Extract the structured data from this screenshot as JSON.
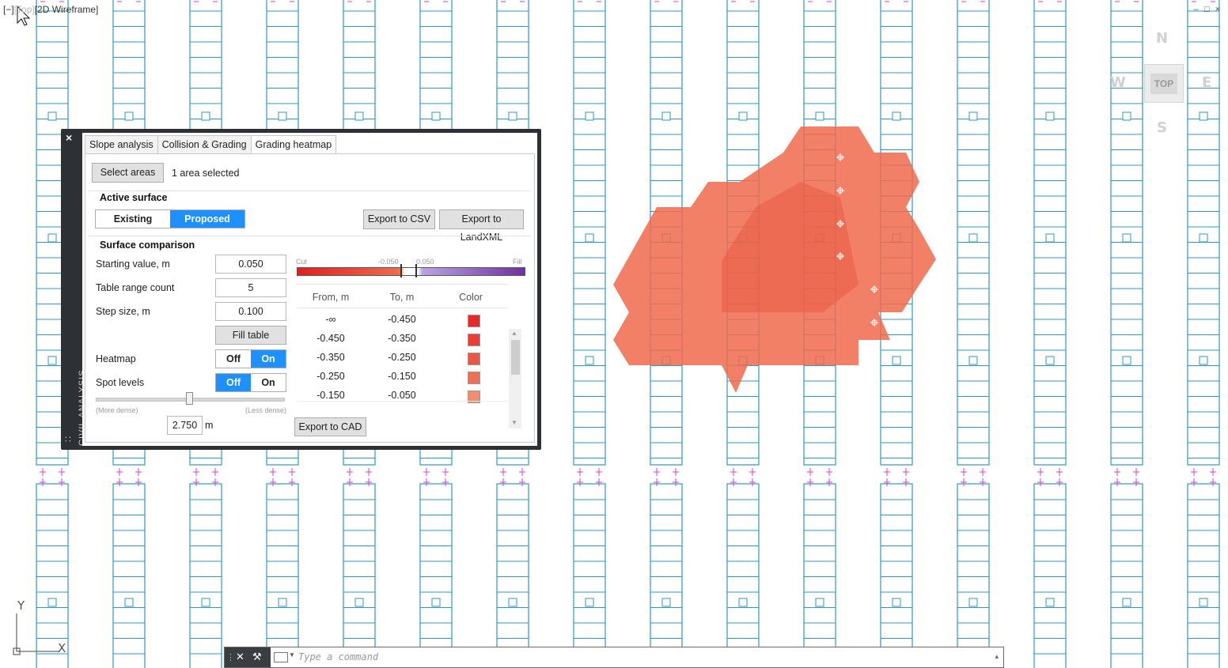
{
  "viewport": {
    "control_label": "[−]",
    "view_label": "[Top]",
    "style_label": "[2D Wireframe]",
    "window_controls": [
      "–",
      "□",
      "×"
    ]
  },
  "viewcube": {
    "n": "N",
    "s": "S",
    "e": "E",
    "w": "W",
    "face": "TOP"
  },
  "ucs": {
    "x": "X",
    "y": "Y"
  },
  "drawing_colors": {
    "rack": "#2b9ac4",
    "pile": "#d63fd6",
    "heatmap": "#ef6a4c"
  },
  "palette": {
    "title": "CIVIL ANALYSIS",
    "close": "×",
    "grip": "∷",
    "tabs": [
      "Slope analysis",
      "Collision & Grading",
      "Grading heatmap"
    ],
    "active_tab": 2,
    "select_areas": "Select areas",
    "selection_status": "1 area selected",
    "active_surface": {
      "header": "Active surface",
      "options": [
        "Existing",
        "Proposed"
      ],
      "selected": "Proposed"
    },
    "export_csv": "Export to CSV",
    "export_landxml": "Export to LandXML",
    "comparison": {
      "header": "Surface comparison",
      "starting_value_label": "Starting value, m",
      "starting_value": "0.050",
      "range_count_label": "Table range count",
      "range_count": "5",
      "step_size_label": "Step size, m",
      "step_size": "0.100",
      "fill_table": "Fill table",
      "heatmap_label": "Heatmap",
      "heatmap_options": [
        "Off",
        "On"
      ],
      "heatmap_selected": "On",
      "spot_levels_label": "Spot levels",
      "spot_levels_options": [
        "Off",
        "On"
      ],
      "spot_levels_selected": "Off",
      "density_more": "(More dense)",
      "density_less": "(Less dense)",
      "density_fraction": 0.5,
      "density_value": "2.750",
      "density_unit": "m"
    },
    "legend": {
      "cut": "Cut",
      "fill": "Fill",
      "low": "-0.050",
      "high": "0.050"
    },
    "table": {
      "headers": [
        "From, m",
        "To, m",
        "Color"
      ],
      "rows": [
        {
          "from": "-∞",
          "to": "-0.450",
          "color": "#e8282b"
        },
        {
          "from": "-0.450",
          "to": "-0.350",
          "color": "#ea3e37"
        },
        {
          "from": "-0.350",
          "to": "-0.250",
          "color": "#ec5645"
        },
        {
          "from": "-0.250",
          "to": "-0.150",
          "color": "#ef7056"
        },
        {
          "from": "-0.150",
          "to": "-0.050",
          "color": "#f28c6d"
        }
      ]
    },
    "export_cad": "Export to CAD"
  },
  "command_line": {
    "close": "✕",
    "settings": "⚒",
    "placeholder": "Type a command",
    "recent_caret": "▴"
  }
}
